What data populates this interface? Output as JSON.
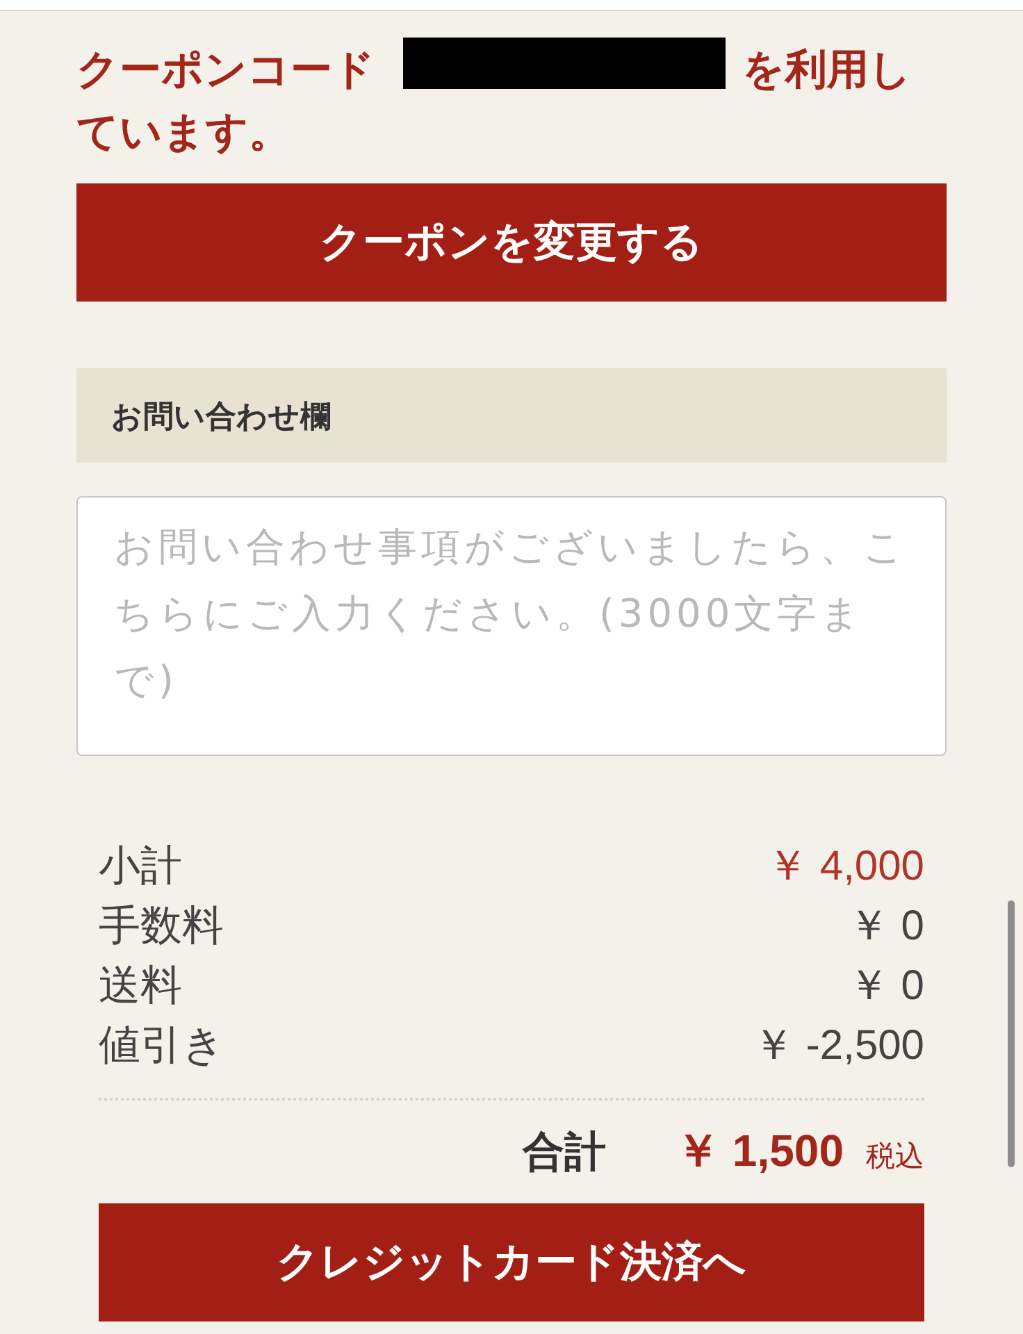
{
  "coupon_notice": {
    "before": "クーポンコード",
    "code_redacted": true,
    "after": "を利用しています。"
  },
  "change_coupon_button": {
    "label": "クーポンを変更する"
  },
  "inquiry": {
    "heading": "お問い合わせ欄",
    "placeholder": "お問い合わせ事項がございましたら、こちらにご入力ください。(3000文字まで)"
  },
  "summary": {
    "rows": [
      {
        "label": "小計",
        "value": "￥ 4,000",
        "emphasized": true
      },
      {
        "label": "手数料",
        "value": "￥ 0",
        "emphasized": false
      },
      {
        "label": "送料",
        "value": "￥ 0",
        "emphasized": false
      },
      {
        "label": "値引き",
        "value": "￥ -2,500",
        "emphasized": false
      }
    ]
  },
  "total": {
    "label": "合計",
    "value": "￥ 1,500",
    "note": "税込"
  },
  "checkout_button": {
    "label": "クレジットカード決済へ"
  }
}
